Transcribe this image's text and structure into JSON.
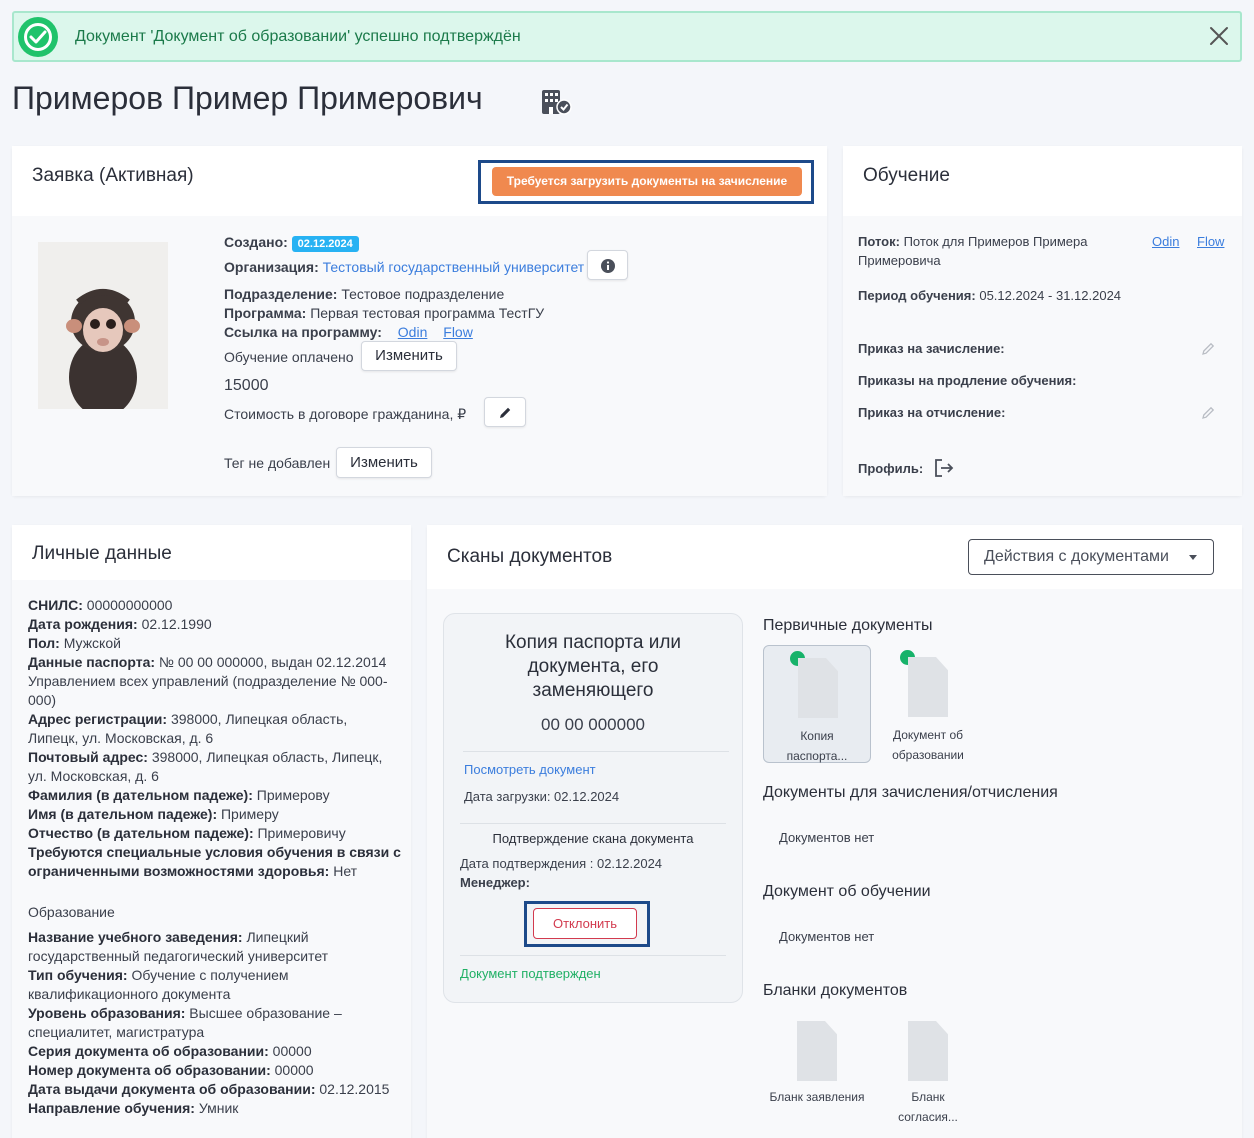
{
  "alert": {
    "message": "Документ 'Документ об образовании' успешно подтверждён"
  },
  "page": {
    "title": "Примеров Пример Примерович"
  },
  "application": {
    "title": "Заявка (Активная)",
    "status_button": "Требуется загрузить документы на зачисление",
    "created_label": "Создано:",
    "created_date": "02.12.2024",
    "org_label": "Организация:",
    "org_value": "Тестовый государственный университет",
    "dept_label": "Подразделение:",
    "dept_value": "Тестовое подразделение",
    "program_label": "Программа:",
    "program_value": "Первая тестовая программа ТестГУ",
    "program_link_label": "Ссылка на программу:",
    "link_odin": "Odin",
    "link_flow": "Flow",
    "paid_label": "Обучение оплачено",
    "change_label": "Изменить",
    "amount": "15000",
    "cost_label": "Стоимость в договоре гражданина, ₽",
    "tag_label": "Тег не добавлен",
    "tag_change_label": "Изменить"
  },
  "education": {
    "title": "Обучение",
    "stream_label": "Поток:",
    "stream_value_1": "Поток для Примеров Примера",
    "stream_value_2": "Примеровича",
    "link_odin": "Odin",
    "link_flow": "Flow",
    "period_label": "Период обучения:",
    "period_value": "05.12.2024 - 31.12.2024",
    "enroll_order_label": "Приказ на зачисление:",
    "extension_orders_label": "Приказы на продление обучения:",
    "expel_order_label": "Приказ на отчисление:",
    "profile_label": "Профиль:"
  },
  "personal": {
    "title": "Личные данные",
    "lines": [
      {
        "label": "СНИЛС:",
        "value": " 00000000000"
      },
      {
        "label": "Дата рождения:",
        "value": " 02.12.1990"
      },
      {
        "label": "Пол:",
        "value": " Мужской"
      },
      {
        "label": "Данные паспорта:",
        "value": " № 00 00 000000, выдан 02.12.2014"
      },
      {
        "label": "",
        "value": "Управлением всех управлений (подразделение № 000-"
      },
      {
        "label": "",
        "value": "000)"
      },
      {
        "label": "Адрес регистрации:",
        "value": " 398000, Липецкая область,"
      },
      {
        "label": "",
        "value": "Липецк, ул. Московская, д. 6"
      },
      {
        "label": "Почтовый адрес:",
        "value": " 398000, Липецкая область, Липецк,"
      },
      {
        "label": "",
        "value": "ул. Московская, д. 6"
      },
      {
        "label": "Фамилия (в дательном падеже):",
        "value": " Примерову"
      },
      {
        "label": "Имя (в дательном падеже):",
        "value": " Примеру"
      },
      {
        "label": "Отчество (в дательном падеже):",
        "value": " Примеровичу"
      },
      {
        "label": "Требуются специальные условия обучения в связи с",
        "value": ""
      },
      {
        "label": "ограниченными возможностями здоровья:",
        "value": " Нет"
      }
    ],
    "education_header": "Образование",
    "education_lines": [
      {
        "label": "Название учебного заведения:",
        "value": " Липецкий"
      },
      {
        "label": "",
        "value": "государственный педагогический университет"
      },
      {
        "label": "Тип обучения:",
        "value": " Обучение с получением"
      },
      {
        "label": "",
        "value": "квалификационного документа"
      },
      {
        "label": "Уровень образования:",
        "value": " Высшее образование –"
      },
      {
        "label": "",
        "value": "специалитет, магистратура"
      },
      {
        "label": "Серия документа об образовании:",
        "value": " 00000"
      },
      {
        "label": "Номер документа об образовании:",
        "value": " 00000"
      },
      {
        "label": "Дата выдачи документа об образовании:",
        "value": " 02.12.2015"
      },
      {
        "label": "Направление обучения:",
        "value": " Умник"
      }
    ]
  },
  "scans": {
    "title": "Сканы документов",
    "actions_label": "Действия с документами",
    "doc_card": {
      "title_1": "Копия паспорта или",
      "title_2": "документа, его",
      "title_3": "заменяющего",
      "number": "00 00 000000",
      "view_link": "Посмотреть документ",
      "upload_date": "Дата загрузки: 02.12.2024",
      "confirm_header": "Подтверждение скана документа",
      "confirm_date": "Дата подтверждения : 02.12.2024",
      "manager_label": "Менеджер:",
      "reject_label": "Отклонить",
      "confirmed_text": "Документ подтвержден"
    },
    "primary_header": "Первичные документы",
    "primary_docs": [
      {
        "label_1": "Копия",
        "label_2": "паспорта..."
      },
      {
        "label_1": "Документ об",
        "label_2": "образовании"
      }
    ],
    "enroll_header": "Документы для зачисления/отчисления",
    "enroll_empty": "Документов нет",
    "edu_doc_header": "Документ об обучении",
    "edu_doc_empty": "Документов нет",
    "blanks_header": "Бланки документов",
    "blanks": [
      {
        "label_1": "Бланк заявления",
        "label_2": ""
      },
      {
        "label_1": "Бланк",
        "label_2": "согласия..."
      }
    ]
  },
  "colors": {
    "accent": "#3b7ddd",
    "success": "#20c36b",
    "warning": "#f0894f",
    "danger": "#d23a4e",
    "highlight": "#1d4a8a"
  }
}
